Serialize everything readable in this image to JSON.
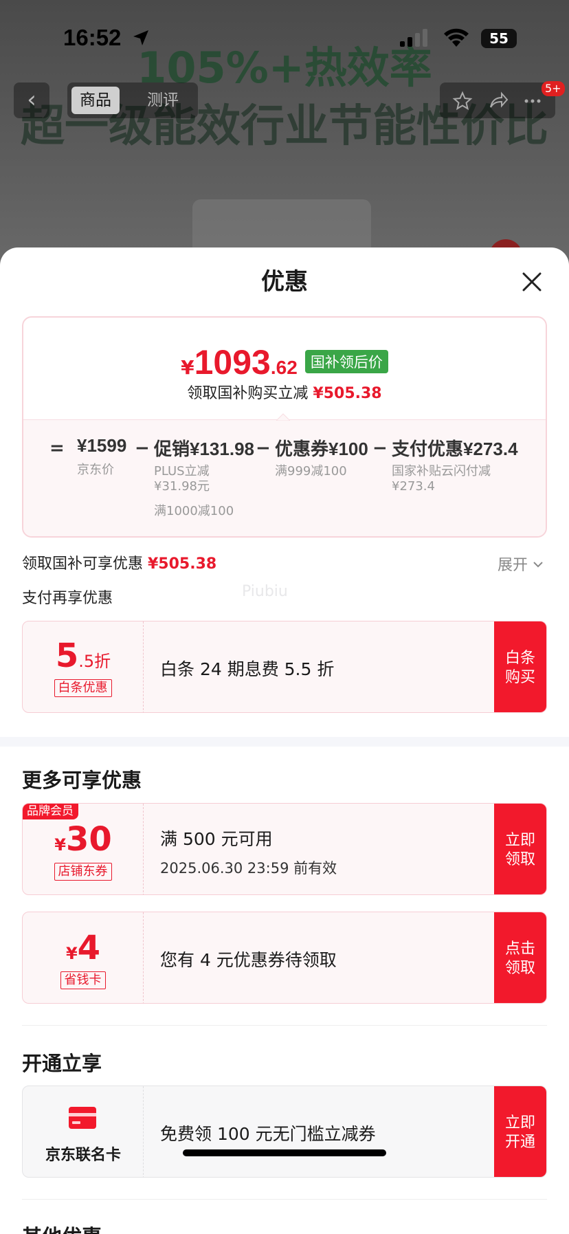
{
  "status_bar": {
    "time": "16:52",
    "battery": "55"
  },
  "background": {
    "headline_1": "105%+热效率",
    "headline_2": "超一级能效行业节能性价比",
    "tabs": [
      "商品",
      "测评"
    ],
    "badge": "5+"
  },
  "sheet": {
    "title": "优惠",
    "price": {
      "currency": "¥",
      "integer": "1093",
      "decimal": ".62",
      "tag": "国补领后价"
    },
    "subline": {
      "text": "领取国补购买立减 ",
      "amount": "¥505.38"
    },
    "breakdown": {
      "eq": "=",
      "minus": "−",
      "items": [
        {
          "value": "¥1599",
          "sub": "京东价"
        },
        {
          "value": "促销¥131.98",
          "sub": "PLUS立减",
          "sub2": "¥31.98元",
          "sub3": "满1000减100"
        },
        {
          "value": "优惠券¥100",
          "sub": "满999减100"
        },
        {
          "value": "支付优惠¥273.4",
          "sub": "国家补贴云闪付减",
          "sub2": "¥273.4"
        }
      ]
    },
    "guobu_row": {
      "text": "领取国补可享优惠 ",
      "amount": "¥505.38",
      "expand": "展开"
    },
    "pay_title": "支付再享优惠",
    "watermark": "Piubiu",
    "baitiao": {
      "big": "5",
      "small": ".5折",
      "label": "白条优惠",
      "desc": "白条 24 期息费 5.5 折",
      "btn1": "白条",
      "btn2": "购买"
    },
    "more_title": "更多可享优惠",
    "coupon_30": {
      "badge": "品牌会员",
      "yen": "¥",
      "amount": "30",
      "label": "店铺东券",
      "line1": "满 500 元可用",
      "line2": "2025.06.30 23:59 前有效",
      "btn1": "立即",
      "btn2": "领取"
    },
    "coupon_4": {
      "yen": "¥",
      "amount": "4",
      "label": "省钱卡",
      "line1": "您有 4 元优惠券待领取",
      "btn1": "点击",
      "btn2": "领取"
    },
    "open_title": "开通立享",
    "card": {
      "name": "京东联名卡",
      "line1": "免费领 100 元无门槛立减券",
      "btn1": "立即",
      "btn2": "开通"
    },
    "other_title": "其他优惠"
  },
  "colors": {
    "accent": "#f2192c",
    "price_red": "#e8192c",
    "tag_green": "#3aa647"
  }
}
